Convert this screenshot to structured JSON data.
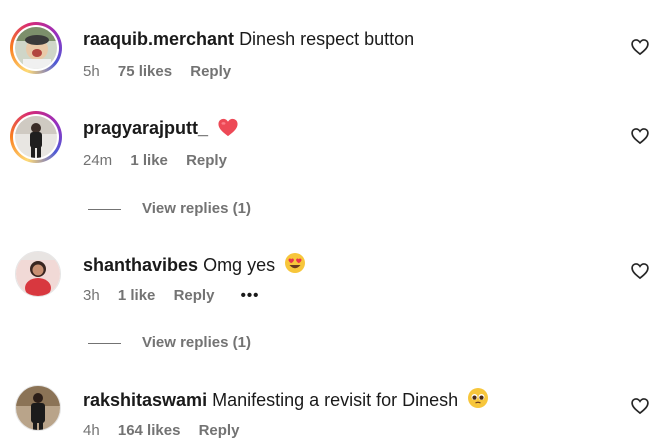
{
  "comments": [
    {
      "username": "raaquib.merchant",
      "text": "Dinesh respect button",
      "time": "5h",
      "likes": "75 likes",
      "reply": "Reply",
      "emoji": ""
    },
    {
      "username": "pragyarajputt_",
      "text": "",
      "time": "24m",
      "likes": "1 like",
      "reply": "Reply",
      "emoji": "red-heart",
      "view_replies": "View replies (1)"
    },
    {
      "username": "shanthavibes",
      "text": "Omg yes",
      "time": "3h",
      "likes": "1 like",
      "reply": "Reply",
      "emoji": "heart-eyes",
      "more": "•••",
      "view_replies": "View replies (1)"
    },
    {
      "username": "rakshitaswami",
      "text": "Manifesting a revisit for Dinesh",
      "time": "4h",
      "likes": "164 likes",
      "reply": "Reply",
      "emoji": "pleading-face"
    }
  ],
  "colors": {
    "meta_gray": "#737373",
    "heart_red": "#ed4956",
    "ring": [
      "#feda75",
      "#fa7e1e",
      "#d62976",
      "#962fbf",
      "#4f5bd5"
    ]
  },
  "icons": {
    "like": "heart-outline-icon"
  }
}
